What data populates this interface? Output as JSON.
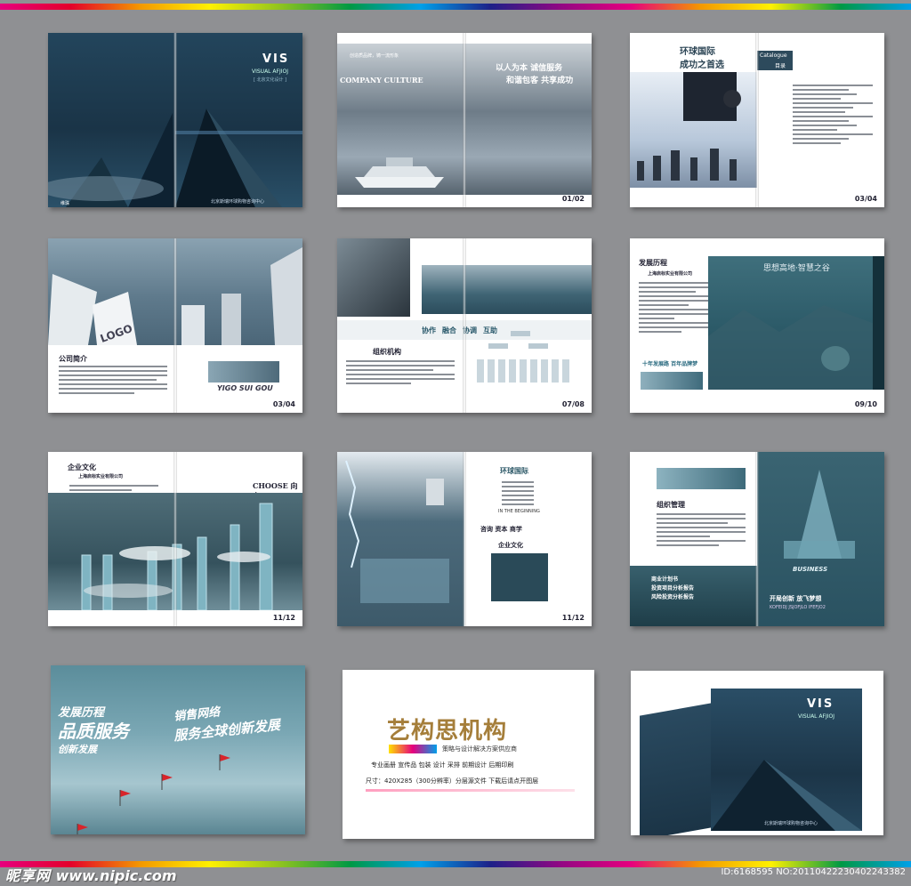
{
  "spreads": {
    "s1": {
      "vis": "VIS",
      "vis_sub": "VISUAL AFJIOJ",
      "vis_small": "[ 北京文化设计 ]",
      "company": "北京斯瑞环球购物咨询中心",
      "logo_text": "维珠"
    },
    "s2": {
      "slogan1": "以人为本  诚信服务",
      "slogan2": "和谐包客  共享成功",
      "culture": "COMPANY CULTURE",
      "small1": "创造质品牌，铸一流形象",
      "page": "01/02"
    },
    "s3": {
      "title1": "环球国际",
      "title2": "成功之首选",
      "catalogue": "Catalogue",
      "catalogue_cn": "目录",
      "page": "03/04"
    },
    "s4": {
      "profile": "公司简介",
      "logo": "LOGO",
      "brand": "YIGO SUI GOU",
      "page": "03/04"
    },
    "s5": {
      "tags": [
        "协作",
        "融合",
        "协调",
        "互助"
      ],
      "heading": "组织机构",
      "page": "07/08"
    },
    "s6": {
      "heading": "发展历程",
      "company": "上海启标实业有限公司",
      "slogan": "十年发展路  百年品牌梦",
      "banner": "思想高地·智慧之谷",
      "page": "09/10"
    },
    "s7": {
      "heading": "企业文化",
      "company": "上海启标实业有限公司",
      "choose": "CHOOSE 向上",
      "page": "11/12"
    },
    "s8": {
      "title": "环球国际",
      "begin": "IN THE BEGINNING",
      "slogan": "咨询  资本  商学",
      "culture": "企业文化",
      "page": "11/12"
    },
    "s9": {
      "heading": "组织管理",
      "plan": [
        "商业计划书",
        "投资项目分析报告",
        "风险投资分析报告"
      ],
      "bottom1": "开局创新  放飞梦想",
      "bottom2": "KOFEIDJ JSJOFJLO IFEFJO2",
      "business": "BUSINESS"
    },
    "s10": {
      "line1": "发展历程",
      "line2": "品质服务",
      "line3": "销售网络",
      "line4": "服务全球创新发展",
      "line5": "创新发展"
    },
    "s11": {
      "brand": "艺构思机构",
      "subtitle": "策略与设计解决方案供应商",
      "services": "专业画册  宣传品  包装  设计  采排  前期设计  后期印刷",
      "size": "尺寸：420X285（300分辨率）分层源文件  下载后请点开图层"
    },
    "s12": {
      "vis": "VIS",
      "vis_sub": "VISUAL AFJIOJ",
      "company": "北京斯瑞环球购物咨询中心"
    }
  },
  "footer": {
    "site_cn": "昵享网",
    "site_url": "www.nipic.com",
    "id": "ID:6168595 NO:20110422230402243382"
  }
}
